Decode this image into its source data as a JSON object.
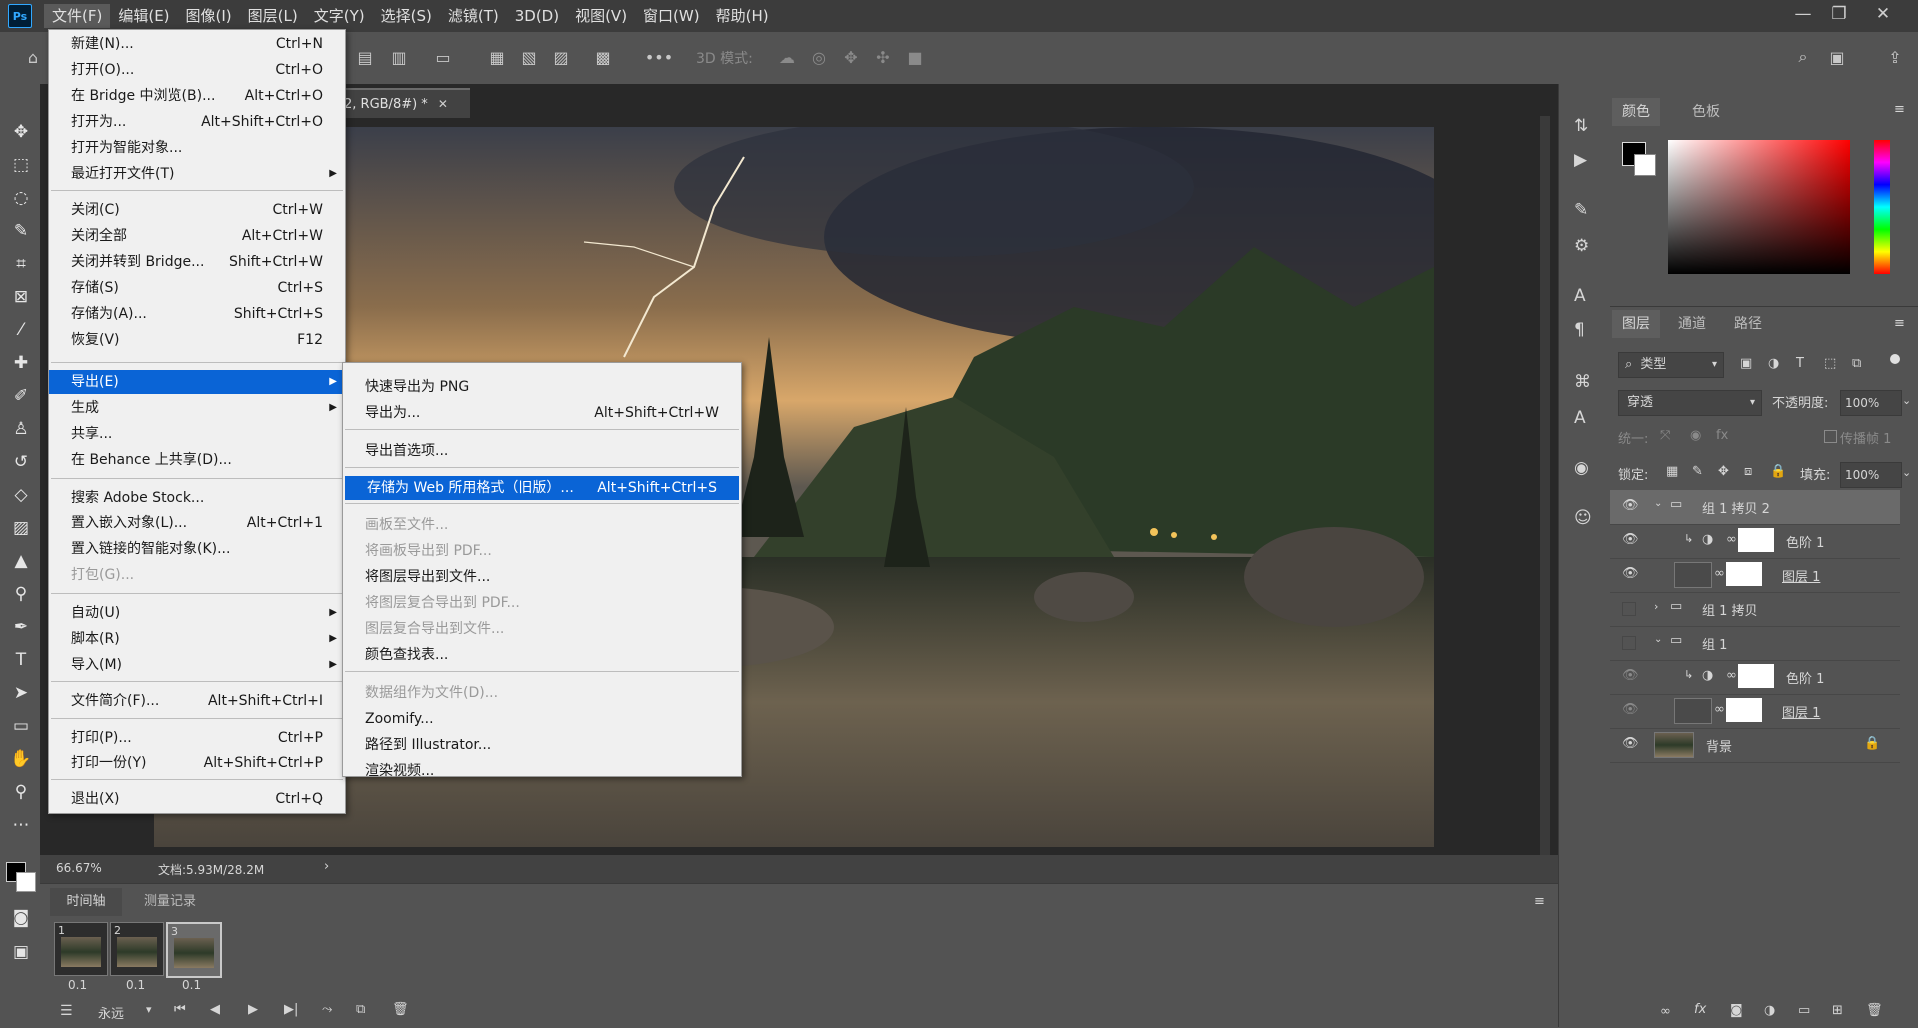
{
  "app": {
    "logo": "Ps"
  },
  "menubar": [
    "文件(F)",
    "编辑(E)",
    "图像(I)",
    "图层(L)",
    "文字(Y)",
    "选择(S)",
    "滤镜(T)",
    "3D(D)",
    "视图(V)",
    "窗口(W)",
    "帮助(H)"
  ],
  "optionsbar": {
    "mode3d_label": "3D 模式:"
  },
  "document": {
    "tab_title": "2, RGB/8#) *",
    "zoom": "66.67%",
    "docinfo": "文档:5.93M/28.2M"
  },
  "file_menu": [
    {
      "label": "新建(N)...",
      "shortcut": "Ctrl+N"
    },
    {
      "label": "打开(O)...",
      "shortcut": "Ctrl+O"
    },
    {
      "label": "在 Bridge 中浏览(B)...",
      "shortcut": "Alt+Ctrl+O"
    },
    {
      "label": "打开为...",
      "shortcut": "Alt+Shift+Ctrl+O"
    },
    {
      "label": "打开为智能对象...",
      "shortcut": ""
    },
    {
      "label": "最近打开文件(T)",
      "shortcut": ""
    },
    {
      "label": "关闭(C)",
      "shortcut": "Ctrl+W"
    },
    {
      "label": "关闭全部",
      "shortcut": "Alt+Ctrl+W"
    },
    {
      "label": "关闭并转到 Bridge...",
      "shortcut": "Shift+Ctrl+W"
    },
    {
      "label": "存储(S)",
      "shortcut": "Ctrl+S"
    },
    {
      "label": "存储为(A)...",
      "shortcut": "Shift+Ctrl+S"
    },
    {
      "label": "恢复(V)",
      "shortcut": "F12"
    },
    {
      "label": "导出(E)",
      "shortcut": ""
    },
    {
      "label": "生成",
      "shortcut": ""
    },
    {
      "label": "共享...",
      "shortcut": ""
    },
    {
      "label": "在 Behance 上共享(D)...",
      "shortcut": ""
    },
    {
      "label": "搜索 Adobe Stock...",
      "shortcut": ""
    },
    {
      "label": "置入嵌入对象(L)...",
      "shortcut": "Alt+Ctrl+1"
    },
    {
      "label": "置入链接的智能对象(K)...",
      "shortcut": ""
    },
    {
      "label": "打包(G)...",
      "shortcut": ""
    },
    {
      "label": "自动(U)",
      "shortcut": ""
    },
    {
      "label": "脚本(R)",
      "shortcut": ""
    },
    {
      "label": "导入(M)",
      "shortcut": ""
    },
    {
      "label": "文件简介(F)...",
      "shortcut": "Alt+Shift+Ctrl+I"
    },
    {
      "label": "打印(P)...",
      "shortcut": "Ctrl+P"
    },
    {
      "label": "打印一份(Y)",
      "shortcut": "Alt+Shift+Ctrl+P"
    },
    {
      "label": "退出(X)",
      "shortcut": "Ctrl+Q"
    }
  ],
  "export_menu": [
    {
      "label": "快速导出为 PNG",
      "shortcut": ""
    },
    {
      "label": "导出为...",
      "shortcut": "Alt+Shift+Ctrl+W"
    },
    {
      "label": "导出首选项...",
      "shortcut": ""
    },
    {
      "label": "存储为 Web 所用格式（旧版）...",
      "shortcut": "Alt+Shift+Ctrl+S"
    },
    {
      "label": "画板至文件...",
      "shortcut": ""
    },
    {
      "label": "将画板导出到 PDF...",
      "shortcut": ""
    },
    {
      "label": "将图层导出到文件...",
      "shortcut": ""
    },
    {
      "label": "将图层复合导出到 PDF...",
      "shortcut": ""
    },
    {
      "label": "图层复合导出到文件...",
      "shortcut": ""
    },
    {
      "label": "颜色查找表...",
      "shortcut": ""
    },
    {
      "label": "数据组作为文件(D)...",
      "shortcut": ""
    },
    {
      "label": "Zoomify...",
      "shortcut": ""
    },
    {
      "label": "路径到 Illustrator...",
      "shortcut": ""
    },
    {
      "label": "渲染视频...",
      "shortcut": ""
    }
  ],
  "color_panel": {
    "tabs": [
      "颜色",
      "色板"
    ]
  },
  "layers_panel": {
    "tabs": [
      "图层",
      "通道",
      "路径"
    ],
    "filter_kind": "类型",
    "blend_mode": "穿透",
    "opacity_label": "不透明度:",
    "opacity": "100%",
    "unify_label": "统一:",
    "propagate_label": "传播帧 1",
    "lock_label": "锁定:",
    "fill_label": "填充:",
    "fill": "100%",
    "layers": [
      {
        "name": "组 1 拷贝 2"
      },
      {
        "name": "色阶 1"
      },
      {
        "name": "图层 1"
      },
      {
        "name": "组 1 拷贝"
      },
      {
        "name": "组 1"
      },
      {
        "name": "色阶 1"
      },
      {
        "name": "图层 1"
      },
      {
        "name": "背景"
      }
    ]
  },
  "timeline": {
    "tabs": [
      "时间轴",
      "测量记录"
    ],
    "frames": [
      {
        "num": "1",
        "delay": "0.1"
      },
      {
        "num": "2",
        "delay": "0.1"
      },
      {
        "num": "3",
        "delay": "0.1"
      }
    ],
    "loop": "永远"
  },
  "colors": {
    "accent": "#0a64d6",
    "ps_blue": "#31a8ff"
  }
}
